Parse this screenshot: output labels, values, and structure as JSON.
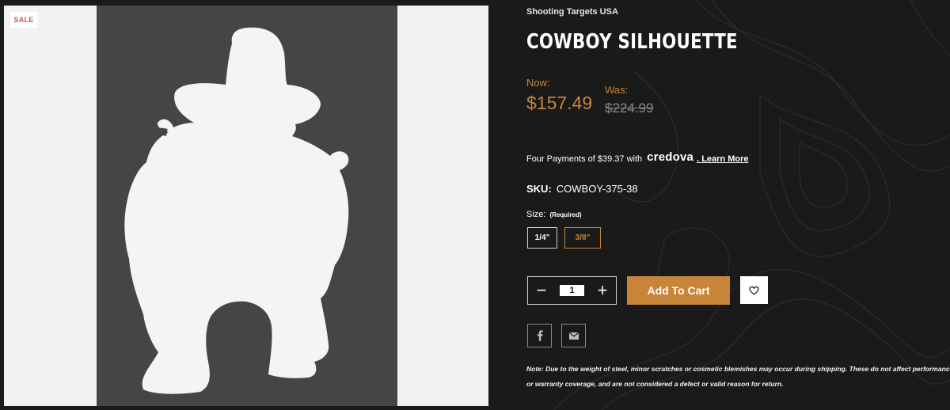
{
  "product": {
    "sale_badge": "SALE",
    "brand": "Shooting Targets USA",
    "title": "COWBOY SILHOUETTE",
    "now_label": "Now:",
    "now_price": "$157.49",
    "was_label": "Was:",
    "was_price": "$224.99",
    "payments_text": "Four Payments of $39.37 with",
    "credova_logo": "credova",
    "learn_more": ". Learn More",
    "sku_label": "SKU:",
    "sku_value": "COWBOY-375-38",
    "size_label": "Size:",
    "size_required": "(Required)",
    "sizes": [
      {
        "label": "1/4\"",
        "selected": false
      },
      {
        "label": "3/8\"",
        "selected": true
      }
    ],
    "quantity": "1",
    "qty_minus": "−",
    "qty_plus": "+",
    "add_to_cart": "Add To Cart",
    "note": "Note: Due to the weight of steel, minor scratches or cosmetic blemishes may occur during shipping. These do not affect performance or warranty coverage, and are not considered a defect or valid reason for return."
  },
  "icons": {
    "wishlist": "heart-icon",
    "facebook": "facebook-icon",
    "email": "email-icon"
  },
  "colors": {
    "background": "#1a1a1a",
    "accent": "#c8853a",
    "sale": "#d9534f",
    "strike": "#8a8a8a"
  }
}
